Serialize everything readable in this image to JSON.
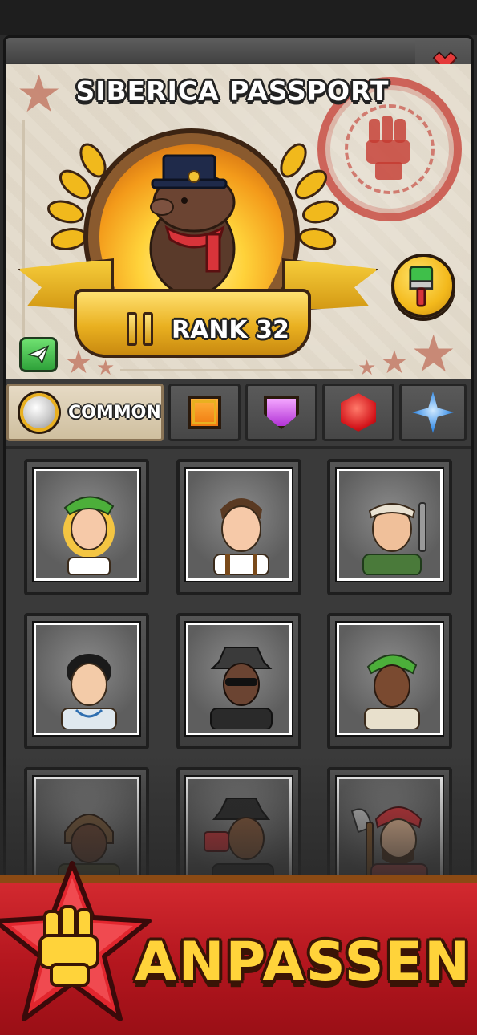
{
  "passport": {
    "title": "SIBERICA PASSPORT",
    "rank_label": "RANK 32",
    "avatar": "capybara-top-hat",
    "stamp": "fist-emblem-stamp"
  },
  "actions": {
    "close_icon": "close-icon",
    "paint_icon": "paintbrush-icon",
    "send_icon": "paper-plane-icon"
  },
  "rarity_tabs": [
    {
      "label": "COMMON",
      "icon": "silver-coin-icon",
      "active": true
    },
    {
      "label": "",
      "icon": "orange-square-gem-icon",
      "active": false
    },
    {
      "label": "",
      "icon": "purple-shield-gem-icon",
      "active": false
    },
    {
      "label": "",
      "icon": "red-hex-gem-icon",
      "active": false
    },
    {
      "label": "",
      "icon": "blue-star-gem-icon",
      "active": false
    }
  ],
  "characters": [
    {
      "name": "blonde-woman-green-cap"
    },
    {
      "name": "man-suspenders"
    },
    {
      "name": "mechanic-wrench"
    },
    {
      "name": "doctor-stethoscope"
    },
    {
      "name": "spy-fedora-sunglasses"
    },
    {
      "name": "farmer-woman-green-cap"
    },
    {
      "name": "aviator-pilot"
    },
    {
      "name": "photographer-camera"
    },
    {
      "name": "lumberjack-axe"
    }
  ],
  "cta": {
    "label": "ANPASSEN",
    "icon": "fist-star-icon"
  },
  "colors": {
    "cta_red": "#c41f27",
    "cta_text": "#ffd33a",
    "gold": "#e9b020",
    "paper": "#e4dccd"
  }
}
